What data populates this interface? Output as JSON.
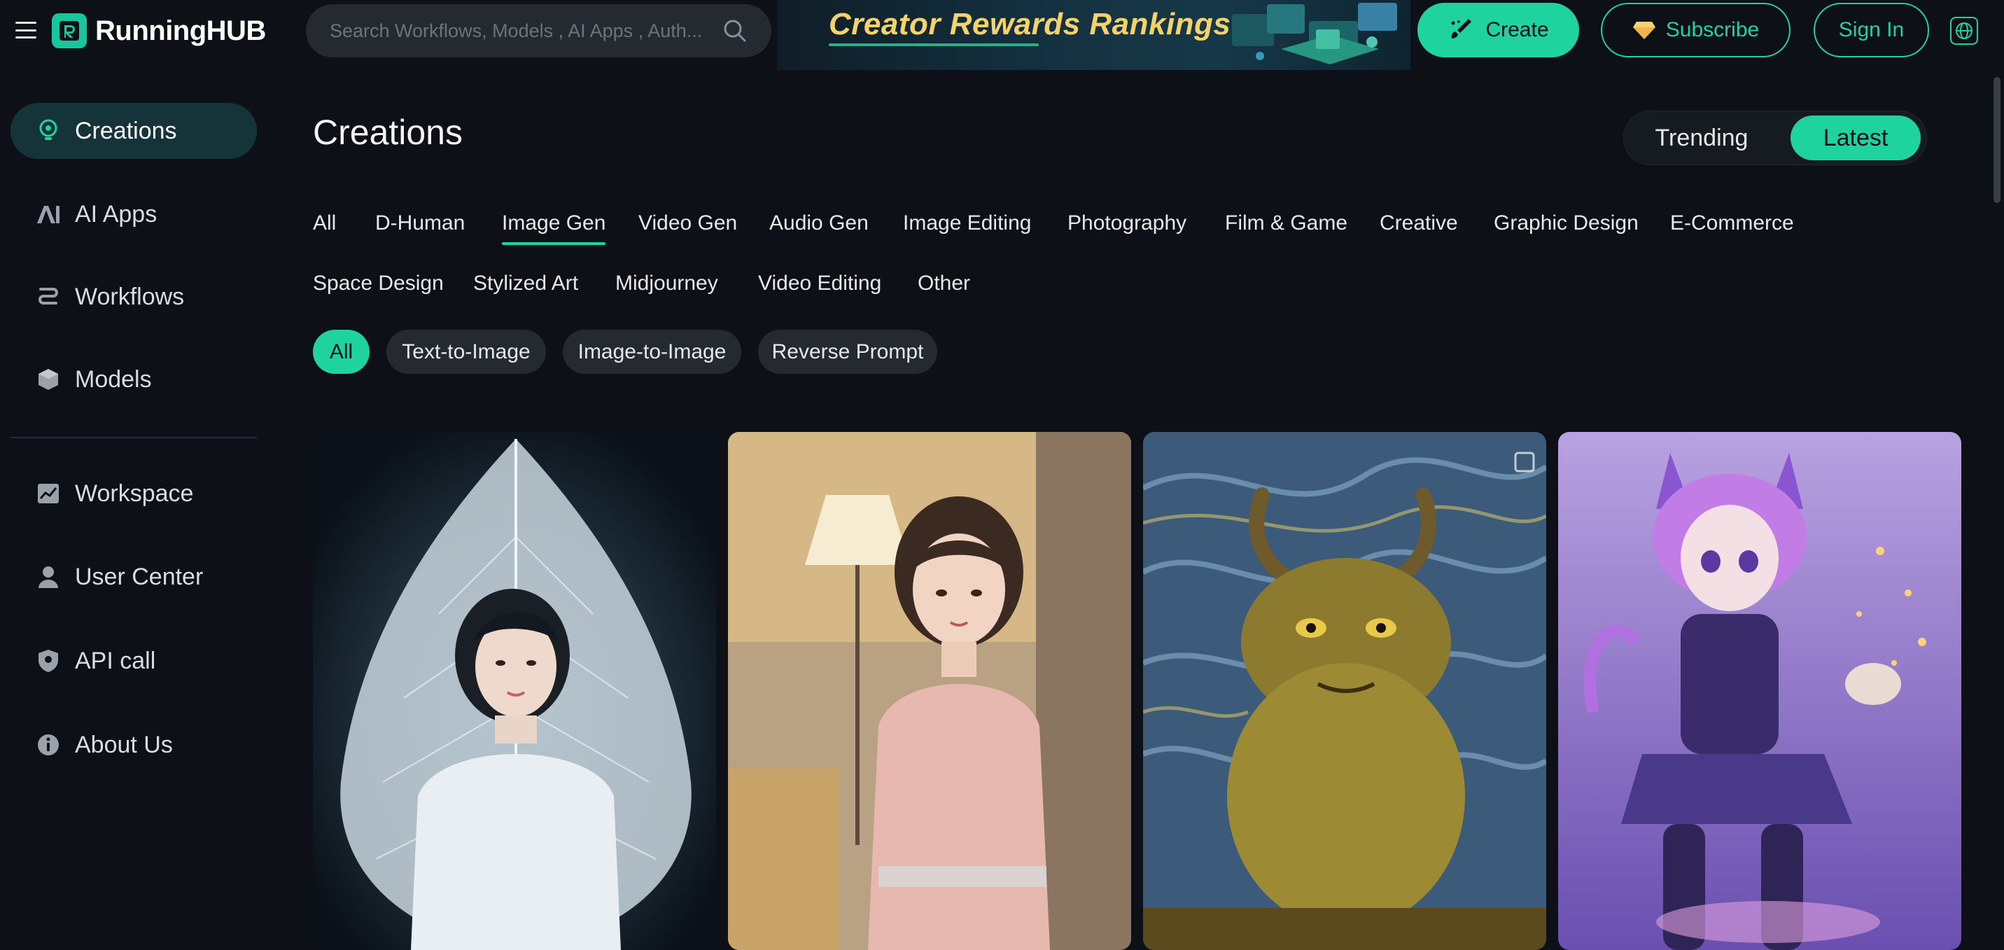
{
  "header": {
    "brand": "RunningHUB",
    "search_placeholder": "Search Workflows, Models , AI Apps , Auth...",
    "banner_text": "Creator Rewards Rankings",
    "create_label": "Create",
    "subscribe_label": "Subscribe",
    "signin_label": "Sign In"
  },
  "sidebar": {
    "items": [
      {
        "label": "Creations",
        "icon": "lightbulb-icon",
        "active": true
      },
      {
        "label": "AI Apps",
        "icon": "ai-icon"
      },
      {
        "label": "Workflows",
        "icon": "workflow-icon"
      },
      {
        "label": "Models",
        "icon": "cube-icon"
      },
      {
        "label": "Workspace",
        "icon": "chart-icon"
      },
      {
        "label": "User Center",
        "icon": "user-icon"
      },
      {
        "label": "API call",
        "icon": "shield-icon"
      },
      {
        "label": "About Us",
        "icon": "info-icon"
      }
    ]
  },
  "main": {
    "title": "Creations",
    "sort": {
      "trending": "Trending",
      "latest": "Latest",
      "selected": "Latest"
    },
    "categories": [
      "All",
      "D-Human",
      "Image Gen",
      "Video Gen",
      "Audio Gen",
      "Image Editing",
      "Photography",
      "Film & Game",
      "Creative",
      "Graphic Design",
      "E-Commerce",
      "Space Design",
      "Stylized Art",
      "Midjourney",
      "Video Editing",
      "Other"
    ],
    "active_category": "Image Gen",
    "subfilters": [
      "All",
      "Text-to-Image",
      "Image-to-Image",
      "Reverse Prompt"
    ],
    "active_subfilter": "All"
  },
  "colors": {
    "accent": "#1fd39f",
    "background": "#0d1117",
    "sidebar_active": "#15343a",
    "banner_text": "#f5d36a"
  }
}
